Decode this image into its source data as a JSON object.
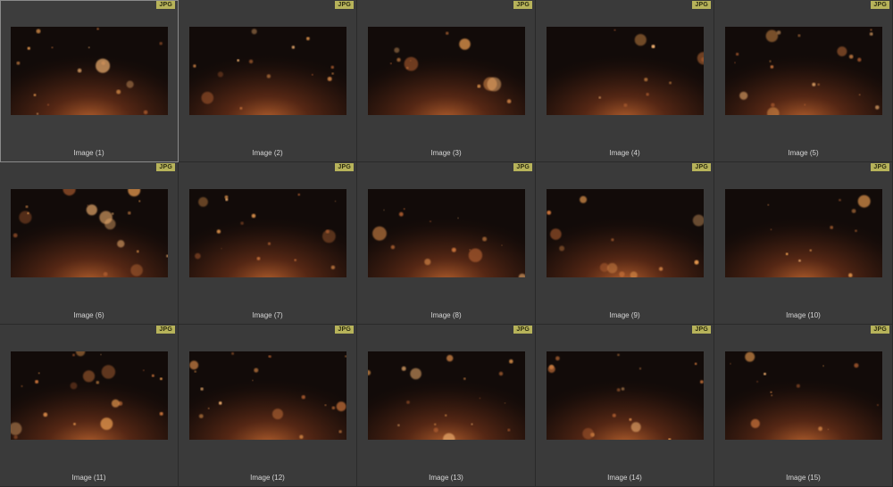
{
  "browser": {
    "badge_text": "JPG",
    "selected_index": 0,
    "items": [
      {
        "name": "Image (1)"
      },
      {
        "name": "Image (2)"
      },
      {
        "name": "Image (3)"
      },
      {
        "name": "Image (4)"
      },
      {
        "name": "Image (5)"
      },
      {
        "name": "Image (6)"
      },
      {
        "name": "Image (7)"
      },
      {
        "name": "Image (8)"
      },
      {
        "name": "Image (9)"
      },
      {
        "name": "Image (10)"
      },
      {
        "name": "Image (11)"
      },
      {
        "name": "Image (12)"
      },
      {
        "name": "Image (13)"
      },
      {
        "name": "Image (14)"
      },
      {
        "name": "Image (15)"
      }
    ]
  },
  "colors": {
    "panel": "#3a3a3a",
    "badge": "#b7b35a",
    "bokeh_glow": "#d9884a"
  }
}
